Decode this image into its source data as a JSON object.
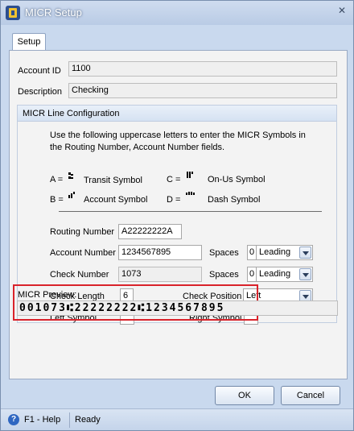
{
  "window": {
    "title": "MICR Setup"
  },
  "tab": {
    "label": "Setup"
  },
  "account": {
    "id_label": "Account ID",
    "id_value": "1100",
    "desc_label": "Description",
    "desc_value": "Checking"
  },
  "micr": {
    "header": "MICR Line Configuration",
    "instructions_line1": "Use the following uppercase letters to enter the MICR Symbols in",
    "instructions_line2": "the Routing Number, Account Number fields.",
    "symbols": [
      {
        "key": "A =",
        "name": "Transit Symbol",
        "icon": "transit-symbol-icon"
      },
      {
        "key": "B =",
        "name": "Account Symbol",
        "icon": "account-symbol-icon"
      },
      {
        "key": "C =",
        "name": "On-Us Symbol",
        "icon": "on-us-symbol-icon"
      },
      {
        "key": "D =",
        "name": "Dash Symbol",
        "icon": "dash-symbol-icon"
      }
    ],
    "routing_label": "Routing Number",
    "routing_value": "A22222222A",
    "account_label": "Account Number",
    "account_value": "1234567895",
    "check_label": "Check Number",
    "check_value": "1073",
    "length_label": "Check Length",
    "length_value": "6",
    "spaces_label": "Spaces",
    "acct_spaces_value": "0",
    "acct_spaces_mode": "Leading",
    "check_spaces_value": "0",
    "check_spaces_mode": "Leading",
    "position_label": "Check Position",
    "position_value": "Left",
    "left_symbol_label": "Left Symbol",
    "right_symbol_label": "Right Symbol",
    "preview_label": "MICR Preview:",
    "preview_value": "001073⑆22222222⑆1234567895"
  },
  "buttons": {
    "ok": "OK",
    "cancel": "Cancel"
  },
  "status": {
    "help": "F1 - Help",
    "state": "Ready"
  },
  "colors": {
    "highlight": "#d9232b",
    "titlebar": "#b9cbe5"
  }
}
